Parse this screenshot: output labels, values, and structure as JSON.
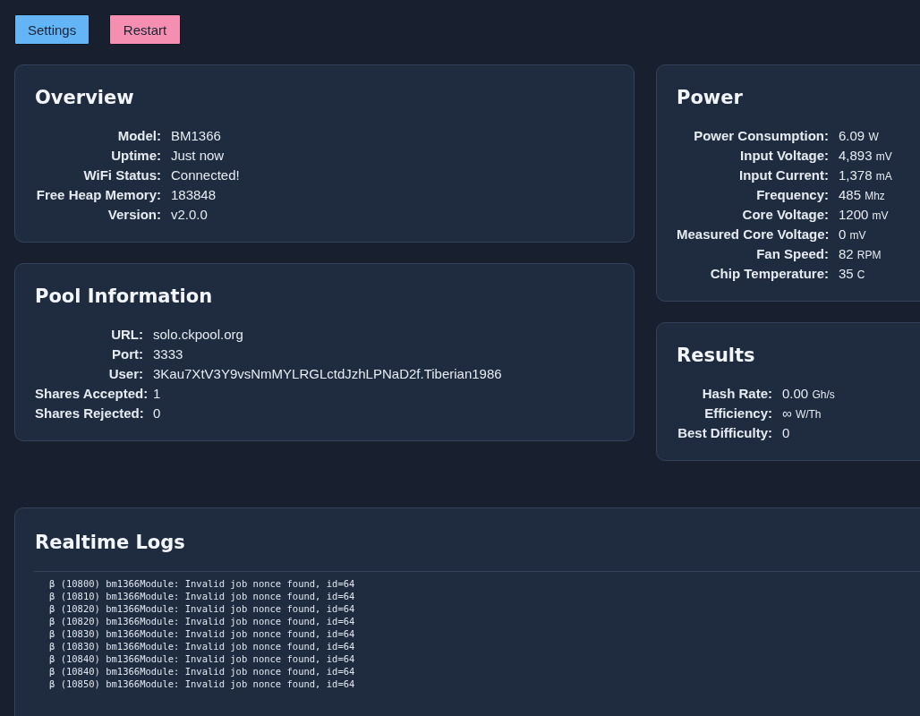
{
  "buttons": [
    {
      "label": "Settings",
      "kind": "primary"
    },
    {
      "label": "Restart",
      "kind": "danger"
    }
  ],
  "overview": {
    "title": "Overview",
    "rows": [
      {
        "label": "Model:",
        "value": "BM1366"
      },
      {
        "label": "Uptime:",
        "value": "Just now"
      },
      {
        "label": "WiFi Status:",
        "value": "Connected!"
      },
      {
        "label": "Free Heap Memory:",
        "value": "183848"
      },
      {
        "label": "Version:",
        "value": "v2.0.0"
      }
    ]
  },
  "pool": {
    "title": "Pool Information",
    "rows": [
      {
        "label": "URL:",
        "value": "solo.ckpool.org"
      },
      {
        "label": "Port:",
        "value": "3333"
      },
      {
        "label": "User:",
        "value": "3Kau7XtV3Y9vsNmMYLRGLctdJzhLPNaD2f.Tiberian1986"
      },
      {
        "label": "Shares Accepted:",
        "value": "1"
      },
      {
        "label": "Shares Rejected:",
        "value": "0"
      }
    ]
  },
  "power": {
    "title": "Power",
    "rows": [
      {
        "label": "Power Consumption:",
        "value": "6.09",
        "unit": "W"
      },
      {
        "label": "Input Voltage:",
        "value": "4,893",
        "unit": "mV"
      },
      {
        "label": "Input Current:",
        "value": "1,378",
        "unit": "mA"
      },
      {
        "label": "Frequency:",
        "value": "485",
        "unit": "Mhz"
      },
      {
        "label": "Core Voltage:",
        "value": "1200",
        "unit": "mV"
      },
      {
        "label": "Measured Core Voltage:",
        "value": "0",
        "unit": "mV"
      },
      {
        "label": "Fan Speed:",
        "value": "82",
        "unit": "RPM"
      },
      {
        "label": "Chip Temperature:",
        "value": "35",
        "unit": "C"
      }
    ]
  },
  "results": {
    "title": "Results",
    "rows": [
      {
        "label": "Hash Rate:",
        "value": "0.00",
        "unit": "Gh/s"
      },
      {
        "label": "Efficiency:",
        "value": "∞",
        "unit": "W/Th"
      },
      {
        "label": "Best Difficulty:",
        "value": "0"
      }
    ]
  },
  "logs": {
    "title": "Realtime Logs",
    "lines": [
      "β (10800) bm1366Module: Invalid job nonce found, id=64",
      "β (10810) bm1366Module: Invalid job nonce found, id=64",
      "β (10820) bm1366Module: Invalid job nonce found, id=64",
      "β (10820) bm1366Module: Invalid job nonce found, id=64",
      "β (10830) bm1366Module: Invalid job nonce found, id=64",
      "β (10830) bm1366Module: Invalid job nonce found, id=64",
      "β (10840) bm1366Module: Invalid job nonce found, id=64",
      "β (10840) bm1366Module: Invalid job nonce found, id=64",
      "β (10850) bm1366Module: Invalid job nonce found, id=64"
    ]
  }
}
